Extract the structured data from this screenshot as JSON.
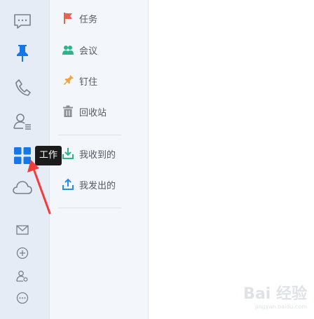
{
  "rail": {
    "icons": [
      "message-icon",
      "pin-icon",
      "phone-icon",
      "contacts-icon",
      "work-grid-icon",
      "cloud-icon"
    ],
    "bottom_icons": [
      "mail-icon",
      "plus-circle-icon",
      "user-settings-icon",
      "more-icon"
    ],
    "active_color": "#1677e6",
    "icon_color": "#7b8088"
  },
  "tooltip": {
    "text": "工作"
  },
  "menu": {
    "items": [
      {
        "label": "任务",
        "icon": "flag-icon",
        "color": "#e8614d"
      },
      {
        "label": "会议",
        "icon": "meeting-icon",
        "color": "#2bb58a"
      },
      {
        "label": "钉住",
        "icon": "pin-icon",
        "color": "#f0a43a"
      },
      {
        "label": "回收站",
        "icon": "trash-icon",
        "color": "#8a8f98"
      },
      {
        "label": "我收到的",
        "icon": "download-icon",
        "color": "#2bb58a"
      },
      {
        "label": "我发出的",
        "icon": "upload-icon",
        "color": "#2b8be6"
      }
    ]
  },
  "annotation": {
    "arrow_color": "#f23c3c"
  },
  "watermark": {
    "main": "Bai 经验",
    "sub": "jingyan.baidu.com"
  }
}
